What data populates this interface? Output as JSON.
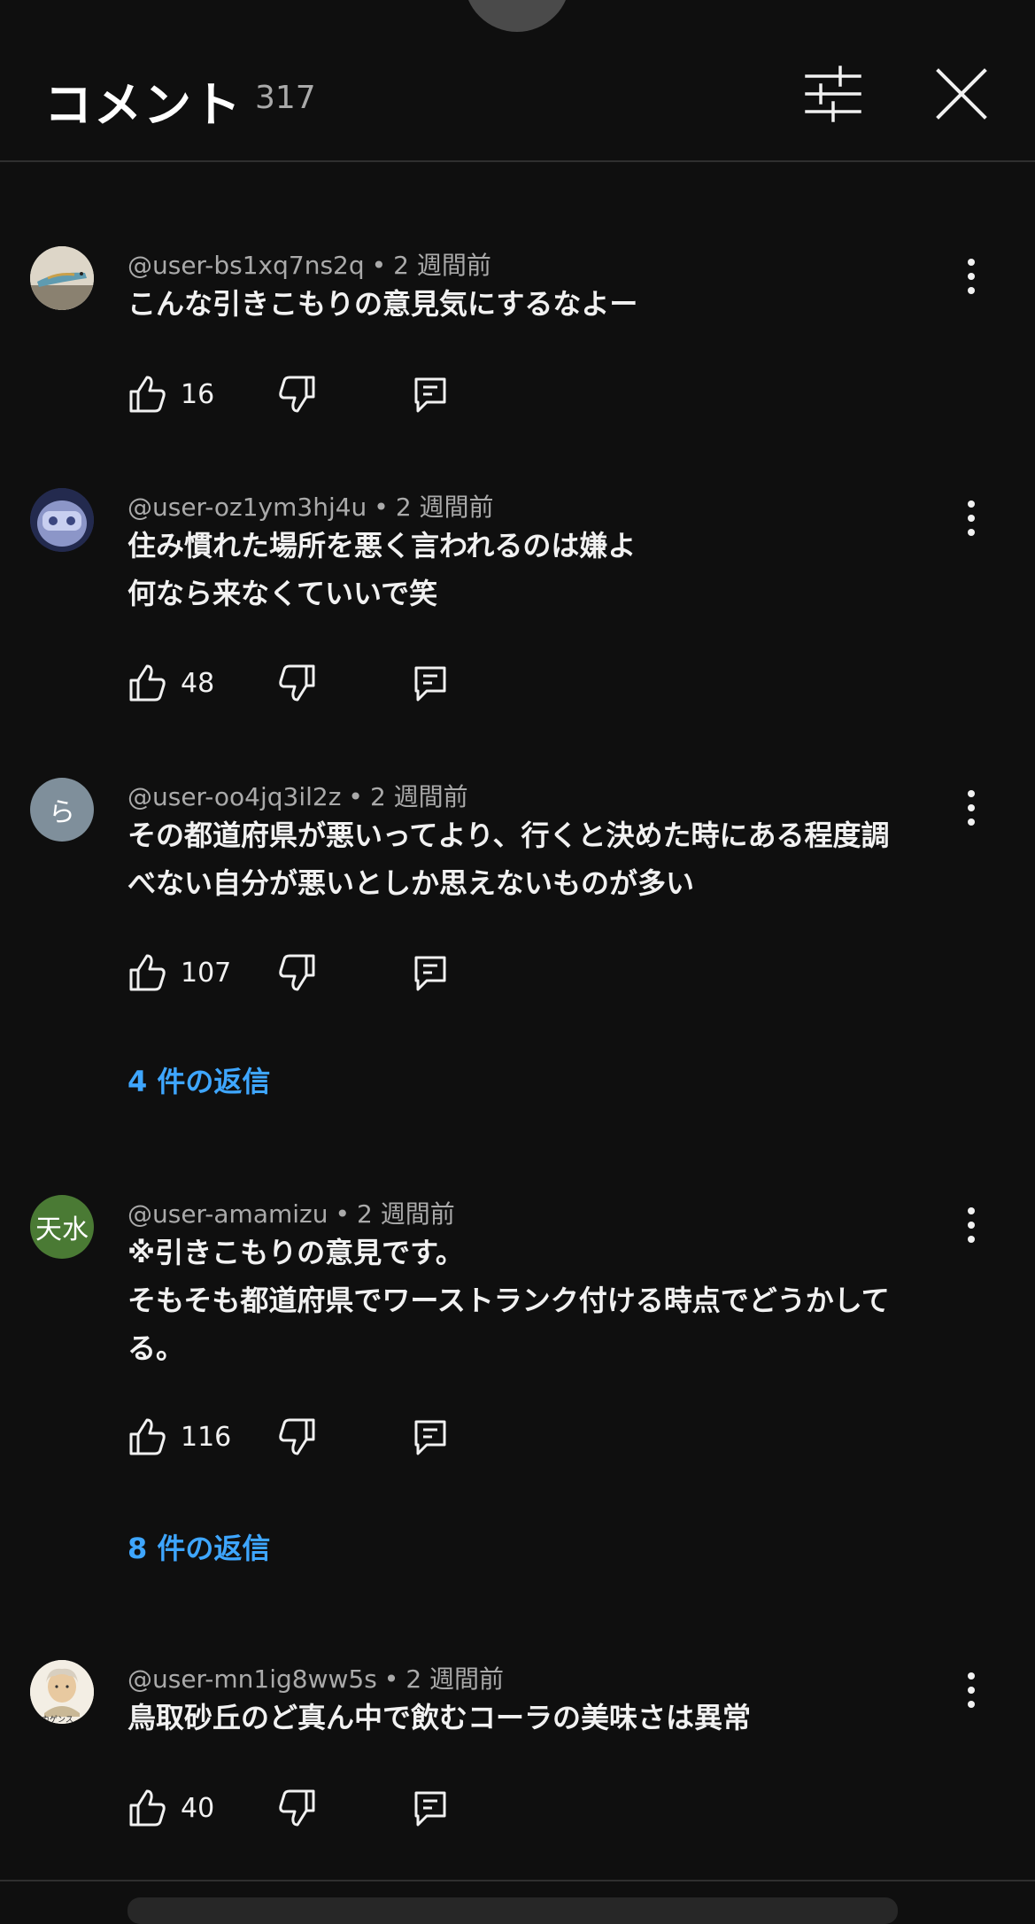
{
  "header": {
    "title": "コメント",
    "count": "317"
  },
  "comments": [
    {
      "author": "@user-bs1xq7ns2q",
      "time": "2 週間前",
      "lines": [
        "こんな引きこもりの意見気にするなよー"
      ],
      "likes": "16",
      "replies": "",
      "avatar": {
        "type": "image",
        "name": "avatar-lizard"
      }
    },
    {
      "author": "@user-oz1ym3hj4u",
      "time": "2 週間前",
      "lines": [
        "住み慣れた場所を悪く言われるのは嫌よ",
        "何なら来なくていいで笑"
      ],
      "likes": "48",
      "replies": "",
      "avatar": {
        "type": "image",
        "name": "avatar-robot"
      }
    },
    {
      "author": "@user-oo4jq3il2z",
      "time": "2 週間前",
      "lines": [
        "その都道府県が悪いってより、行くと決めた時にある程度調",
        "べない自分が悪いとしか思えないものが多い"
      ],
      "likes": "107",
      "replies": "4 件の返信",
      "avatar": {
        "type": "letter",
        "letter": "ら",
        "color": "#7f8f9b"
      }
    },
    {
      "author": "@user-amamizu",
      "time": "2 週間前",
      "lines": [
        "※引きこもりの意見です。",
        "そもそも都道府県でワーストランク付ける時点でどうかして",
        "る。"
      ],
      "likes": "116",
      "replies": "8 件の返信",
      "avatar": {
        "type": "letter",
        "letter": "天水",
        "color": "#4a7a34"
      }
    },
    {
      "author": "@user-mn1ig8ww5s",
      "time": "2 週間前",
      "lines": [
        "鳥取砂丘のど真ん中で飲むコーラの美味さは異常"
      ],
      "likes": "40",
      "replies": "",
      "avatar": {
        "type": "image",
        "name": "avatar-portrait",
        "caption": "ニカゲンス"
      }
    }
  ],
  "colors": {
    "background": "#0f0f0f",
    "text": "#f1f1f1",
    "meta": "#aaaaaa",
    "link": "#3ea6ff"
  }
}
